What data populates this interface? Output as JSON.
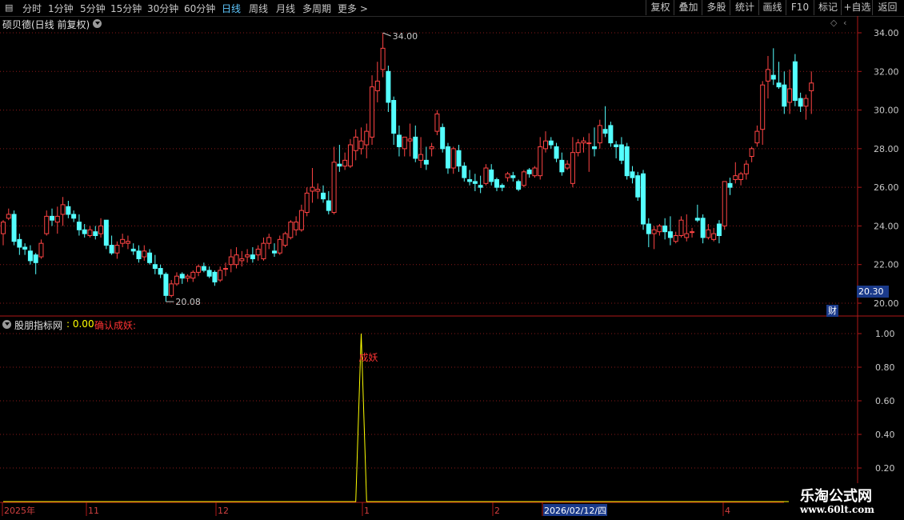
{
  "toolbar": {
    "tabs": [
      "分时",
      "1分钟",
      "5分钟",
      "15分钟",
      "30分钟",
      "60分钟",
      "日线",
      "周线",
      "月线",
      "多周期",
      "更多 >"
    ],
    "active_tab": "日线",
    "right_buttons": [
      "复权",
      "叠加",
      "多股",
      "统计",
      "画线",
      "F10",
      "标记",
      "+自选",
      "返回"
    ]
  },
  "main_panel": {
    "title": "硕贝德(日线 前复权)",
    "high_label": "34.00",
    "low_label": "20.08",
    "current_price": "20.30",
    "fin_badge": "财",
    "y_ticks": [
      "34.00",
      "32.00",
      "30.00",
      "28.00",
      "26.00",
      "24.00",
      "22.00",
      "20.00"
    ]
  },
  "indicator_panel": {
    "name": "股朋指标网",
    "value": ": 0.00",
    "signal_name": "确认成妖:",
    "signal_mark": "成妖",
    "y_ticks": [
      "1.00",
      "0.80",
      "0.60",
      "0.40",
      "0.20"
    ]
  },
  "date_axis": {
    "labels": [
      "2025年",
      "11",
      "12",
      "1",
      "2",
      "2026/02/12/四",
      "4"
    ]
  },
  "watermark": {
    "line1": "乐淘公式网",
    "line2": "www.60lt.com"
  },
  "colors": {
    "up": "#ff4444",
    "down": "#54ffff",
    "indicator": "#ffff00",
    "grid": "#8a1a1a",
    "axis": "#b01818"
  },
  "chart_data": [
    {
      "type": "candlestick",
      "title": "硕贝德(日线 前复权)",
      "ylim": [
        20.0,
        34.0
      ],
      "y_ticks": [
        34,
        32,
        30,
        28,
        26,
        24,
        22,
        20
      ],
      "marked_high": 34.0,
      "marked_low": 20.08,
      "ohlc": [
        [
          23.6,
          24.3,
          23.0,
          24.2
        ],
        [
          24.4,
          24.9,
          24.3,
          24.6
        ],
        [
          24.6,
          24.8,
          23.0,
          23.2
        ],
        [
          23.3,
          23.6,
          22.5,
          22.9
        ],
        [
          22.9,
          23.1,
          22.5,
          22.8
        ],
        [
          22.7,
          23.0,
          22.0,
          22.2
        ],
        [
          22.5,
          22.6,
          21.5,
          22.1
        ],
        [
          22.4,
          23.3,
          22.3,
          23.1
        ],
        [
          23.6,
          24.8,
          23.5,
          24.5
        ],
        [
          24.5,
          24.9,
          24.0,
          24.3
        ],
        [
          24.2,
          25.0,
          23.6,
          24.5
        ],
        [
          24.6,
          25.5,
          24.0,
          25.1
        ],
        [
          25.0,
          25.3,
          24.4,
          24.6
        ],
        [
          24.6,
          24.8,
          24.2,
          24.4
        ],
        [
          24.2,
          24.6,
          23.5,
          23.8
        ],
        [
          23.8,
          24.1,
          23.4,
          23.6
        ],
        [
          23.5,
          24.0,
          23.4,
          23.8
        ],
        [
          23.7,
          24.0,
          23.3,
          23.5
        ],
        [
          23.6,
          24.4,
          23.4,
          24.0
        ],
        [
          24.3,
          24.3,
          22.8,
          23.0
        ],
        [
          23.0,
          23.5,
          22.5,
          22.6
        ],
        [
          22.6,
          23.2,
          22.3,
          23.0
        ],
        [
          23.1,
          23.6,
          22.9,
          23.3
        ],
        [
          23.1,
          23.5,
          22.8,
          23.2
        ],
        [
          22.8,
          23.1,
          22.5,
          22.7
        ],
        [
          22.7,
          23.0,
          22.1,
          22.3
        ],
        [
          22.4,
          23.0,
          22.2,
          22.7
        ],
        [
          22.6,
          22.8,
          22.0,
          22.1
        ],
        [
          22.0,
          22.5,
          21.5,
          21.8
        ],
        [
          21.8,
          22.0,
          21.3,
          21.5
        ],
        [
          21.5,
          21.6,
          20.08,
          20.4
        ],
        [
          20.4,
          21.2,
          20.3,
          21.0
        ],
        [
          21.0,
          21.6,
          20.9,
          21.4
        ],
        [
          21.5,
          21.6,
          21.0,
          21.3
        ],
        [
          21.3,
          21.5,
          21.1,
          21.4
        ],
        [
          21.3,
          21.7,
          21.1,
          21.6
        ],
        [
          21.6,
          22.0,
          21.4,
          21.9
        ],
        [
          21.9,
          22.1,
          21.6,
          21.7
        ],
        [
          21.7,
          21.9,
          21.3,
          21.4
        ],
        [
          21.6,
          21.7,
          20.9,
          21.1
        ],
        [
          21.2,
          21.9,
          21.1,
          21.7
        ],
        [
          21.8,
          22.1,
          21.4,
          21.8
        ],
        [
          22.0,
          22.8,
          21.6,
          22.4
        ],
        [
          22.0,
          22.9,
          21.8,
          22.5
        ],
        [
          22.2,
          22.7,
          21.9,
          22.3
        ],
        [
          22.4,
          22.8,
          22.1,
          22.5
        ],
        [
          22.5,
          22.9,
          22.1,
          22.3
        ],
        [
          22.5,
          23.0,
          22.2,
          22.8
        ],
        [
          22.3,
          23.4,
          22.2,
          23.1
        ],
        [
          23.1,
          23.6,
          22.8,
          23.4
        ],
        [
          22.7,
          23.1,
          22.4,
          22.6
        ],
        [
          22.6,
          23.5,
          22.5,
          23.3
        ],
        [
          23.0,
          23.7,
          22.9,
          23.6
        ],
        [
          23.4,
          24.3,
          23.3,
          24.2
        ],
        [
          23.8,
          24.5,
          23.5,
          24.2
        ],
        [
          23.8,
          25.1,
          23.7,
          24.8
        ],
        [
          24.7,
          26.0,
          24.5,
          25.7
        ],
        [
          25.8,
          27.0,
          25.2,
          26.0
        ],
        [
          25.8,
          26.2,
          25.4,
          25.9
        ],
        [
          25.7,
          26.1,
          25.2,
          25.4
        ],
        [
          25.3,
          25.8,
          24.6,
          24.8
        ],
        [
          24.7,
          28.1,
          24.6,
          27.3
        ],
        [
          27.2,
          28.2,
          26.8,
          27.1
        ],
        [
          27.1,
          27.8,
          26.9,
          27.4
        ],
        [
          27.1,
          28.5,
          27.0,
          28.2
        ],
        [
          27.9,
          29.0,
          27.4,
          28.6
        ],
        [
          28.0,
          29.1,
          27.7,
          28.4
        ],
        [
          28.2,
          29.3,
          27.5,
          28.9
        ],
        [
          28.6,
          31.8,
          28.2,
          31.2
        ],
        [
          31.0,
          32.5,
          30.4,
          31.5
        ],
        [
          32.1,
          34.0,
          31.7,
          33.2
        ],
        [
          32.0,
          32.3,
          29.9,
          30.4
        ],
        [
          30.5,
          30.7,
          28.2,
          28.8
        ],
        [
          28.7,
          29.2,
          27.6,
          28.1
        ],
        [
          28.0,
          28.6,
          27.6,
          28.6
        ],
        [
          28.4,
          29.3,
          27.6,
          28.5
        ],
        [
          28.6,
          29.2,
          27.3,
          27.5
        ],
        [
          27.4,
          28.6,
          27.0,
          27.7
        ],
        [
          27.4,
          28.1,
          26.9,
          27.2
        ],
        [
          28.0,
          28.3,
          27.6,
          28.1
        ],
        [
          28.9,
          30.0,
          28.7,
          29.8
        ],
        [
          29.1,
          29.3,
          27.8,
          28.0
        ],
        [
          28.1,
          28.3,
          26.7,
          27.0
        ],
        [
          27.0,
          28.1,
          26.7,
          28.0
        ],
        [
          27.9,
          28.2,
          26.8,
          27.1
        ],
        [
          27.1,
          27.3,
          26.3,
          26.5
        ],
        [
          26.4,
          26.9,
          26.1,
          26.3
        ],
        [
          26.3,
          26.7,
          25.8,
          26.2
        ],
        [
          26.1,
          26.6,
          25.7,
          26.0
        ],
        [
          26.2,
          27.2,
          26.1,
          27.0
        ],
        [
          26.9,
          27.2,
          26.1,
          26.3
        ],
        [
          26.4,
          26.5,
          25.8,
          26.0
        ],
        [
          26.1,
          26.2,
          25.8,
          26.0
        ],
        [
          26.5,
          26.8,
          26.3,
          26.7
        ],
        [
          26.6,
          26.8,
          26.3,
          26.5
        ],
        [
          26.3,
          26.4,
          25.8,
          25.9
        ],
        [
          26.1,
          26.9,
          26.0,
          26.8
        ],
        [
          26.9,
          27.0,
          26.5,
          26.7
        ],
        [
          26.6,
          27.1,
          26.5,
          27.0
        ],
        [
          26.6,
          28.6,
          26.4,
          28.1
        ],
        [
          28.0,
          28.9,
          27.8,
          28.4
        ],
        [
          28.4,
          28.6,
          28.0,
          28.2
        ],
        [
          28.1,
          28.3,
          27.3,
          27.5
        ],
        [
          27.4,
          27.8,
          26.6,
          26.8
        ],
        [
          27.0,
          27.4,
          26.9,
          27.2
        ],
        [
          26.2,
          28.6,
          26.0,
          27.8
        ],
        [
          27.8,
          28.5,
          27.6,
          28.3
        ],
        [
          28.3,
          28.6,
          27.8,
          28.4
        ],
        [
          28.3,
          28.8,
          26.8,
          28.3
        ],
        [
          28.1,
          29.1,
          27.6,
          28.0
        ],
        [
          28.3,
          29.5,
          28.0,
          29.2
        ],
        [
          29.0,
          30.2,
          28.6,
          28.8
        ],
        [
          29.2,
          29.4,
          28.1,
          28.3
        ],
        [
          28.2,
          28.4,
          27.5,
          28.1
        ],
        [
          28.2,
          28.6,
          27.2,
          27.4
        ],
        [
          28.1,
          28.3,
          26.4,
          26.6
        ],
        [
          26.8,
          27.1,
          26.2,
          26.5
        ],
        [
          26.6,
          26.8,
          25.3,
          25.5
        ],
        [
          26.7,
          26.9,
          23.8,
          24.1
        ],
        [
          24.1,
          24.4,
          22.9,
          23.6
        ],
        [
          23.6,
          24.0,
          22.8,
          23.8
        ],
        [
          23.7,
          24.1,
          23.5,
          24.0
        ],
        [
          24.0,
          24.4,
          23.3,
          23.7
        ],
        [
          23.7,
          24.5,
          23.0,
          23.4
        ],
        [
          23.2,
          23.7,
          23.1,
          23.5
        ],
        [
          23.5,
          24.5,
          23.4,
          24.3
        ],
        [
          23.4,
          24.6,
          23.2,
          23.6
        ],
        [
          23.7,
          23.9,
          23.4,
          23.7
        ],
        [
          24.4,
          25.1,
          24.2,
          24.3
        ],
        [
          24.4,
          24.6,
          23.1,
          23.4
        ],
        [
          23.4,
          24.1,
          23.3,
          23.8
        ],
        [
          23.3,
          23.9,
          23.2,
          23.6
        ],
        [
          24.1,
          24.3,
          23.1,
          23.5
        ],
        [
          24.0,
          26.3,
          23.8,
          26.3
        ],
        [
          26.2,
          26.5,
          25.6,
          26.0
        ],
        [
          26.4,
          27.3,
          26.2,
          26.6
        ],
        [
          26.4,
          26.8,
          26.1,
          26.7
        ],
        [
          26.7,
          27.4,
          26.4,
          27.2
        ],
        [
          27.6,
          28.1,
          27.3,
          28.0
        ],
        [
          28.3,
          29.2,
          28.1,
          28.9
        ],
        [
          29.0,
          31.5,
          28.2,
          31.3
        ],
        [
          31.5,
          32.8,
          30.6,
          32.1
        ],
        [
          31.8,
          33.2,
          31.3,
          31.6
        ],
        [
          31.4,
          32.5,
          31.1,
          31.2
        ],
        [
          31.3,
          32.0,
          29.8,
          30.2
        ],
        [
          30.4,
          32.1,
          29.8,
          31.1
        ],
        [
          32.5,
          32.9,
          30.2,
          30.5
        ],
        [
          30.6,
          30.9,
          29.9,
          30.2
        ],
        [
          30.2,
          30.8,
          29.5,
          30.6
        ],
        [
          31.0,
          32.0,
          29.8,
          31.4
        ]
      ]
    },
    {
      "type": "line",
      "title": "股朋指标网",
      "series_name": "确认成妖",
      "ylim": [
        0.0,
        1.0
      ],
      "y_ticks": [
        1.0,
        0.8,
        0.6,
        0.4,
        0.2
      ],
      "pulses": [
        {
          "index": 66,
          "value": 1.0
        }
      ],
      "base_value": 0.0,
      "last_value": 0.0
    }
  ]
}
